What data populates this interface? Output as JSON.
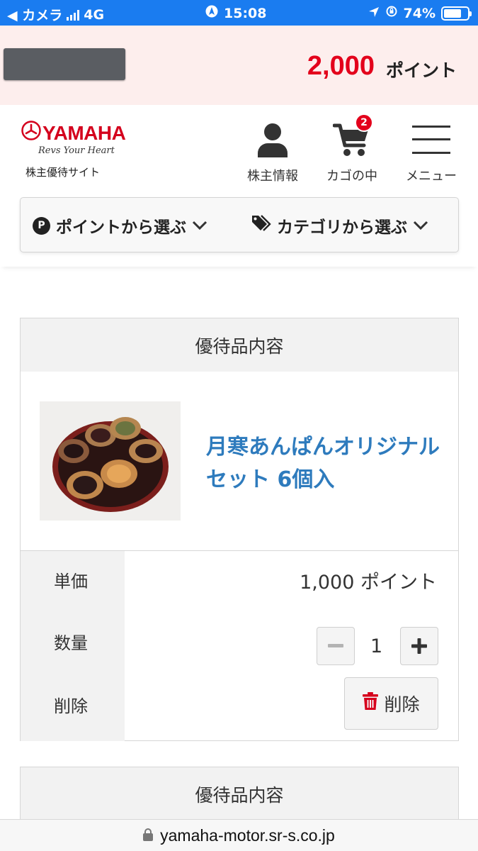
{
  "status_bar": {
    "back_app": "◀ カメラ",
    "network": "4G",
    "time": "15:08",
    "battery_percent": "74%",
    "battery_level": 0.74
  },
  "points": {
    "value": "2,000",
    "unit": "ポイント"
  },
  "header": {
    "logo_text": "YAMAHA",
    "logo_tagline": "Revs Your Heart",
    "site_name": "株主優待サイト",
    "nav": {
      "member_label": "株主情報",
      "cart_label": "カゴの中",
      "cart_count": "2",
      "menu_label": "メニュー"
    },
    "filters": {
      "by_points": "ポイントから選ぶ",
      "by_category": "カテゴリから選ぶ"
    }
  },
  "cart": {
    "section_heading": "優待品内容",
    "item": {
      "name": "月寒あんぱんオリジナルセット 6個入",
      "unit_price_label": "単価",
      "unit_price": "1,000 ポイント",
      "quantity_label": "数量",
      "quantity": "1",
      "delete_label": "削除",
      "delete_button": "削除"
    },
    "next_section_heading": "優待品内容"
  },
  "url_bar": {
    "url": "yamaha-motor.sr-s.co.jp"
  },
  "colors": {
    "status_bar": "#1a7cf0",
    "points_bg": "#fdeeed",
    "points_red": "#e3001b",
    "brand_red": "#d4001d",
    "link_blue": "#2e7bbd"
  }
}
